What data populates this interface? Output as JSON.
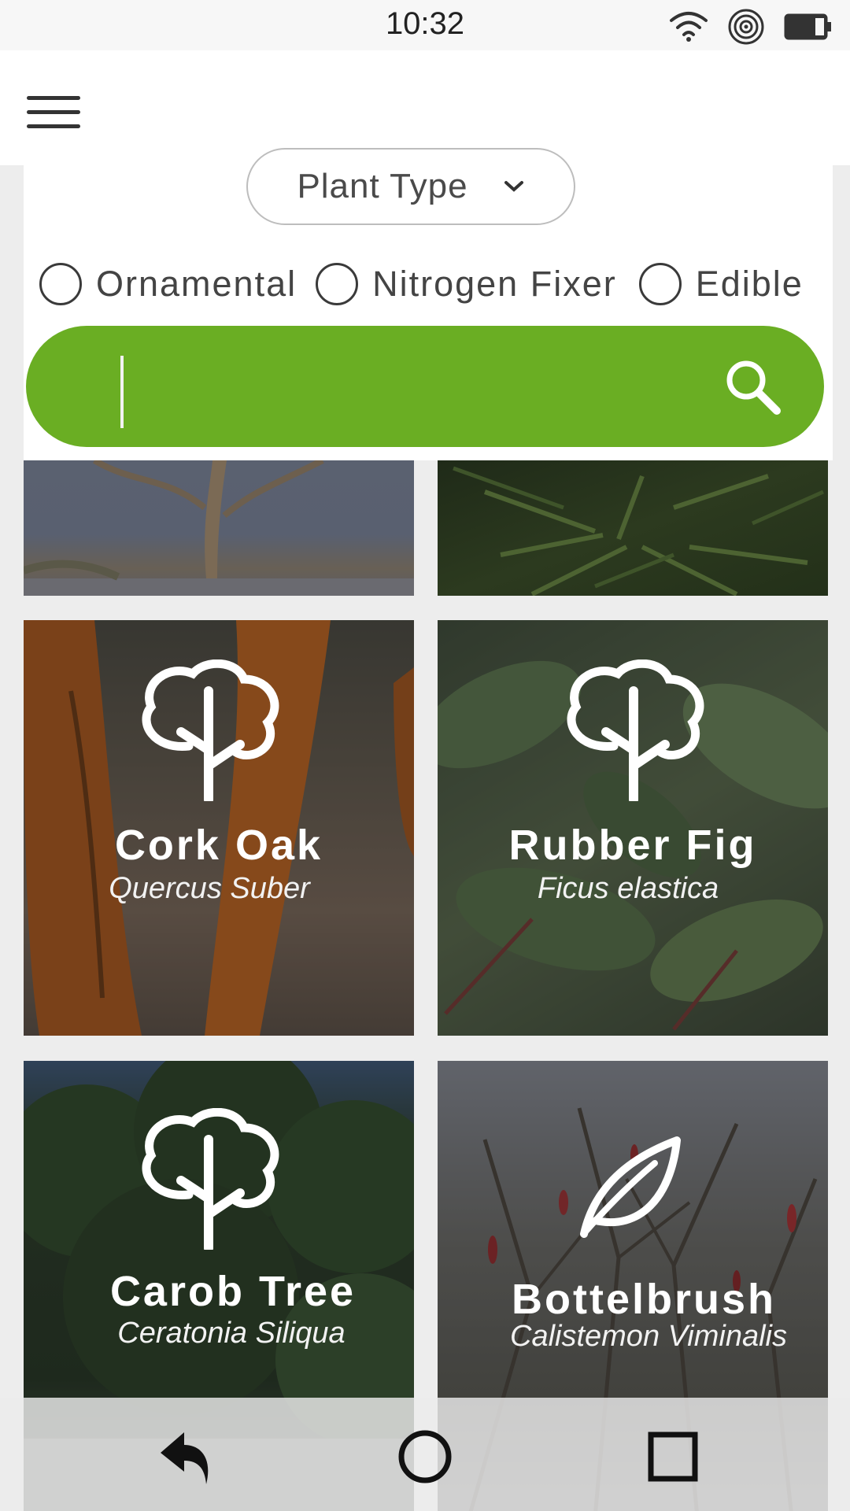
{
  "status": {
    "time": "10:32"
  },
  "filter": {
    "type_label": "Plant Type",
    "options": [
      {
        "label": "Ornamental",
        "checked": false
      },
      {
        "label": "Nitrogen Fixer",
        "checked": false
      },
      {
        "label": "Edible",
        "checked": false
      }
    ],
    "search_value": ""
  },
  "plants": [
    {
      "name": "Cork Oak",
      "latin": "Quercus Suber",
      "icon": "tree-icon"
    },
    {
      "name": "Rubber Fig",
      "latin": "Ficus elastica",
      "icon": "tree-icon"
    },
    {
      "name": "Carob Tree",
      "latin": "Ceratonia Siliqua",
      "icon": "tree-icon"
    },
    {
      "name": "Bottelbrush",
      "latin": "Calistemon Viminalis",
      "icon": "leaf-icon"
    }
  ],
  "nav": {
    "back": "back-icon",
    "home": "home-icon",
    "recents": "recents-icon"
  },
  "colors": {
    "accent": "#6aae23"
  }
}
